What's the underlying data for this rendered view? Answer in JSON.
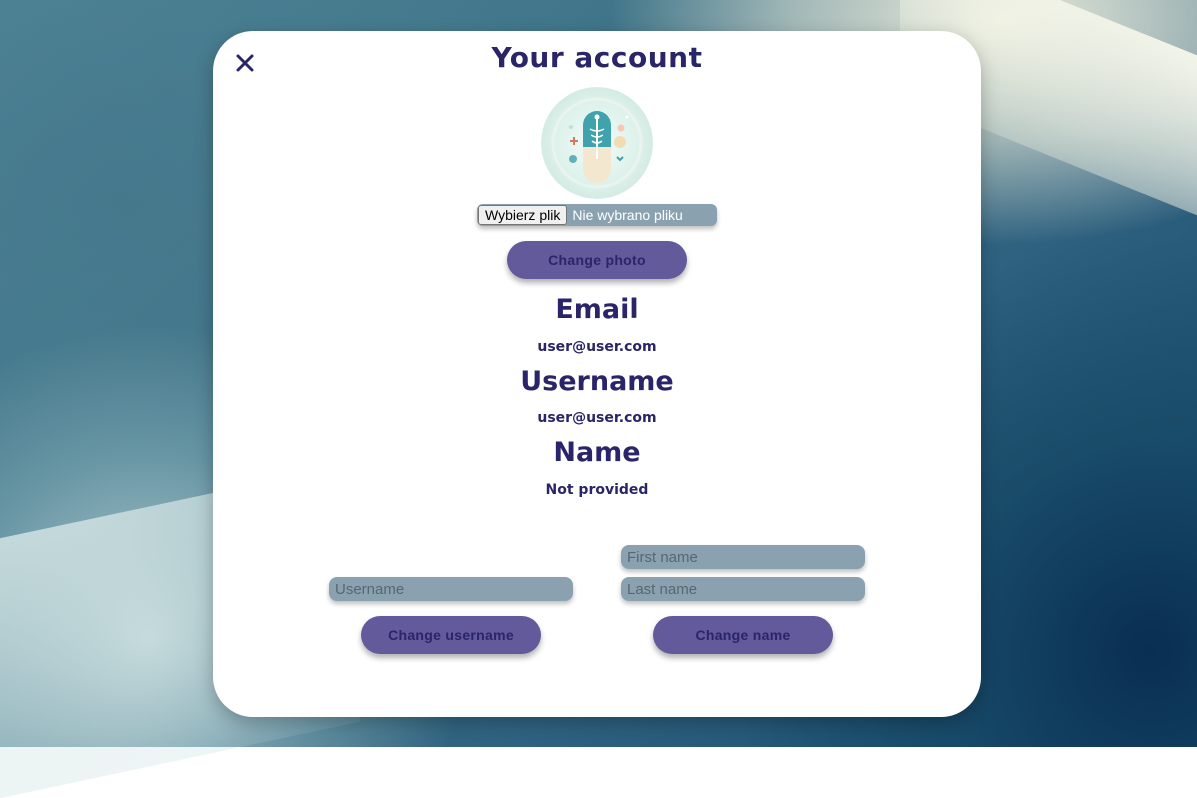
{
  "modal": {
    "title": "Your account",
    "close_icon": "close-icon"
  },
  "photo": {
    "file_button_label": "Wybierz plik",
    "file_status": "Nie wybrano pliku",
    "change_photo_label": "Change photo"
  },
  "profile": {
    "email_heading": "Email",
    "email_value": "user@user.com",
    "username_heading": "Username",
    "username_value": "user@user.com",
    "name_heading": "Name",
    "name_value": "Not provided"
  },
  "forms": {
    "username_placeholder": "Username",
    "first_name_placeholder": "First name",
    "last_name_placeholder": "Last name",
    "change_username_label": "Change username",
    "change_name_label": "Change name"
  },
  "colors": {
    "accent": "#625a9a",
    "text": "#2a2468",
    "field": "#8aa2b0"
  }
}
